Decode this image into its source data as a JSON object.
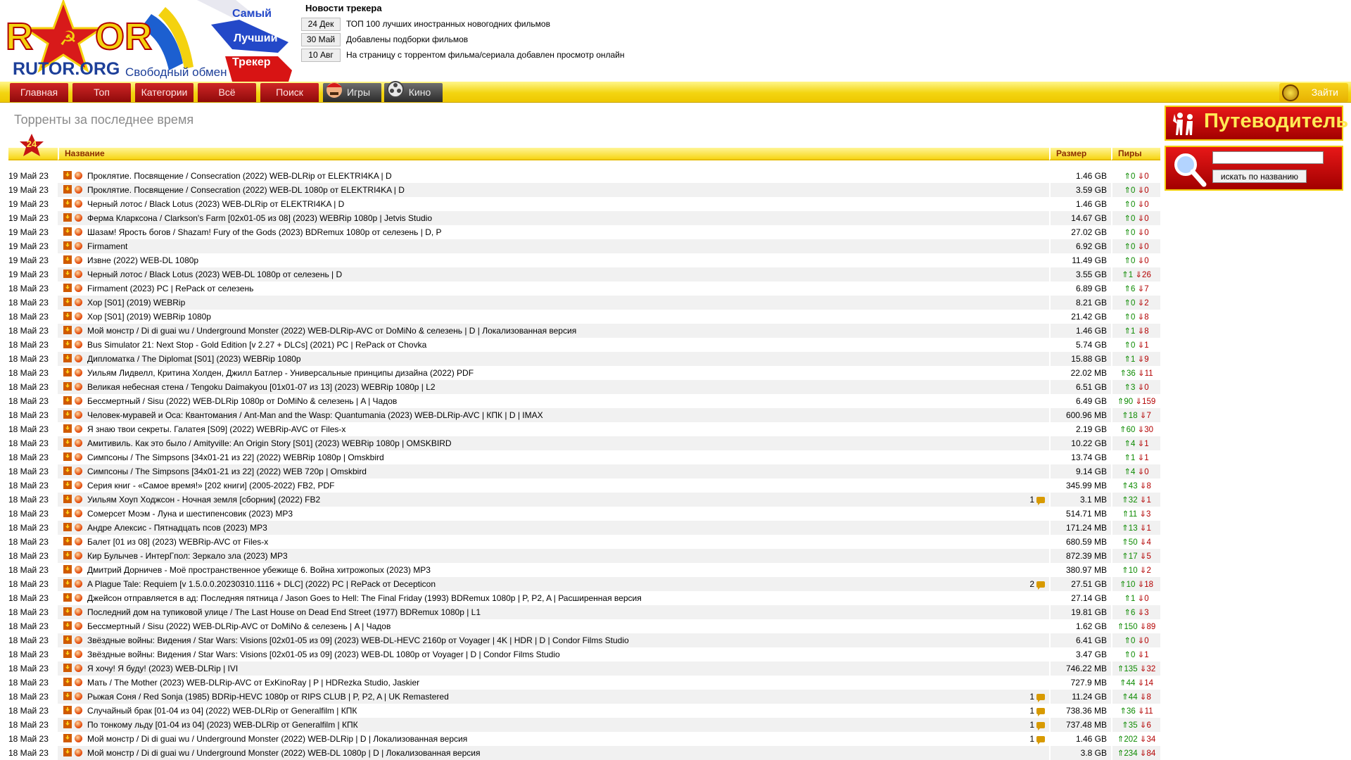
{
  "logo": {
    "text": "RUTOR.ORG",
    "slogan": "Свободный обмен",
    "flag_words": [
      "Самый",
      "Лучший",
      "Трекер"
    ]
  },
  "news": {
    "title": "Новости трекера",
    "items": [
      {
        "date": "24 Дек",
        "text": "ТОП 100 лучших иностранных новогодних фильмов"
      },
      {
        "date": "30 Май",
        "text": "Добавлены подборки фильмов"
      },
      {
        "date": "10 Авг",
        "text": "На страницу с торрентом фильма/сериала добавлен просмотр онлайн"
      }
    ]
  },
  "nav": {
    "tabs": [
      "Главная",
      "Топ",
      "Категории",
      "Всё",
      "Поиск"
    ],
    "games": "Игры",
    "kino": "Кино",
    "login": "Зайти"
  },
  "page_title": "Торренты за последнее время",
  "table": {
    "badge": "24",
    "headers": {
      "name": "Название",
      "size": "Размер",
      "peers": "Пиры"
    },
    "rows": [
      {
        "date": "19 Май 23",
        "title": "Проклятие. Посвящение / Consecration (2022) WEB-DLRip от ELEKTRI4KA | D",
        "com": "",
        "size": "1.46 GB",
        "seed": "0",
        "leech": "0"
      },
      {
        "date": "19 Май 23",
        "title": "Проклятие. Посвящение / Consecration (2022) WEB-DL 1080p от ELEKTRI4KA | D",
        "com": "",
        "size": "3.59 GB",
        "seed": "0",
        "leech": "0"
      },
      {
        "date": "19 Май 23",
        "title": "Черный лотос / Black Lotus (2023) WEB-DLRip от ELEKTRI4KA | D",
        "com": "",
        "size": "1.46 GB",
        "seed": "0",
        "leech": "0"
      },
      {
        "date": "19 Май 23",
        "title": "Ферма Кларксона / Clarkson's Farm [02x01-05 из 08] (2023) WEBRip 1080p | Jetvis Studio",
        "com": "",
        "size": "14.67 GB",
        "seed": "0",
        "leech": "0"
      },
      {
        "date": "19 Май 23",
        "title": "Шазам! Ярость богов / Shazam! Fury of the Gods (2023) BDRemux 1080p от селезень | D, P",
        "com": "",
        "size": "27.02 GB",
        "seed": "0",
        "leech": "0"
      },
      {
        "date": "19 Май 23",
        "title": "Firmament",
        "com": "",
        "size": "6.92 GB",
        "seed": "0",
        "leech": "0"
      },
      {
        "date": "19 Май 23",
        "title": "Извне (2022) WEB-DL 1080p",
        "com": "",
        "size": "11.49 GB",
        "seed": "0",
        "leech": "0"
      },
      {
        "date": "19 Май 23",
        "title": "Черный лотос / Black Lotus (2023) WEB-DL 1080p от селезень | D",
        "com": "",
        "size": "3.55 GB",
        "seed": "1",
        "leech": "26"
      },
      {
        "date": "18 Май 23",
        "title": "Firmament (2023) PC | RePack от селезень",
        "com": "",
        "size": "6.89 GB",
        "seed": "6",
        "leech": "7"
      },
      {
        "date": "18 Май 23",
        "title": "Хор [S01] (2019) WEBRip",
        "com": "",
        "size": "8.21 GB",
        "seed": "0",
        "leech": "2"
      },
      {
        "date": "18 Май 23",
        "title": "Хор [S01] (2019) WEBRip 1080p",
        "com": "",
        "size": "21.42 GB",
        "seed": "0",
        "leech": "8"
      },
      {
        "date": "18 Май 23",
        "title": "Мой монстр / Di di guai wu / Underground Monster (2022) WEB-DLRip-AVC от DoMiNo & селезень | D | Локализованная версия",
        "com": "",
        "size": "1.46 GB",
        "seed": "1",
        "leech": "8"
      },
      {
        "date": "18 Май 23",
        "title": "Bus Simulator 21: Next Stop - Gold Edition [v 2.27 + DLCs] (2021) PC | RePack от Chovka",
        "com": "",
        "size": "5.74 GB",
        "seed": "0",
        "leech": "1"
      },
      {
        "date": "18 Май 23",
        "title": "Дипломатка / The Diplomat [S01] (2023) WEBRip 1080p",
        "com": "",
        "size": "15.88 GB",
        "seed": "1",
        "leech": "9"
      },
      {
        "date": "18 Май 23",
        "title": "Уильям Лидвелл, Критина Холден, Джилл Батлер - Универсальные принципы дизайна (2022) PDF",
        "com": "",
        "size": "22.02 MB",
        "seed": "36",
        "leech": "11"
      },
      {
        "date": "18 Май 23",
        "title": "Великая небесная стена / Tengoku Daimakyou [01x01-07 из 13] (2023) WEBRip 1080p | L2",
        "com": "",
        "size": "6.51 GB",
        "seed": "3",
        "leech": "0"
      },
      {
        "date": "18 Май 23",
        "title": "Бессмертный / Sisu (2022) WEB-DLRip 1080p от DoMiNo & селезень | A | Чадов",
        "com": "",
        "size": "6.49 GB",
        "seed": "90",
        "leech": "159"
      },
      {
        "date": "18 Май 23",
        "title": "Человек-муравей и Оса: Квантомания / Ant-Man and the Wasp: Quantumania (2023) WEB-DLRip-AVC | КПК | D | IMAX",
        "com": "",
        "size": "600.96 MB",
        "seed": "18",
        "leech": "7"
      },
      {
        "date": "18 Май 23",
        "title": "Я знаю твои секреты. Галатея [S09] (2022) WEBRip-AVC от Files-x",
        "com": "",
        "size": "2.19 GB",
        "seed": "60",
        "leech": "30"
      },
      {
        "date": "18 Май 23",
        "title": "Амитивиль. Как это было / Amityville: An Origin Story [S01] (2023) WEBRip 1080p | OMSKBIRD",
        "com": "",
        "size": "10.22 GB",
        "seed": "4",
        "leech": "1"
      },
      {
        "date": "18 Май 23",
        "title": "Симпсоны / The Simpsons [34x01-21 из 22] (2022) WEBRip 1080p | Omskbird",
        "com": "",
        "size": "13.74 GB",
        "seed": "1",
        "leech": "1"
      },
      {
        "date": "18 Май 23",
        "title": "Симпсоны / The Simpsons [34x01-21 из 22] (2022) WEB 720p | Omskbird",
        "com": "",
        "size": "9.14 GB",
        "seed": "4",
        "leech": "0"
      },
      {
        "date": "18 Май 23",
        "title": "Серия книг - «Самое время!» [202 книги] (2005-2022) FB2, PDF",
        "com": "",
        "size": "345.99 MB",
        "seed": "43",
        "leech": "8"
      },
      {
        "date": "18 Май 23",
        "title": "Уильям Хоуп Ходжсон - Ночная земля [сборник] (2022) FB2",
        "com": "1",
        "size": "3.1 MB",
        "seed": "32",
        "leech": "1"
      },
      {
        "date": "18 Май 23",
        "title": "Сомерсет Моэм - Луна и шестипенсовик (2023) MP3",
        "com": "",
        "size": "514.71 MB",
        "seed": "11",
        "leech": "3"
      },
      {
        "date": "18 Май 23",
        "title": "Андре Алексис - Пятнадцать псов (2023) MP3",
        "com": "",
        "size": "171.24 MB",
        "seed": "13",
        "leech": "1"
      },
      {
        "date": "18 Май 23",
        "title": "Балет [01 из 08] (2023) WEBRip-AVC от Files-x",
        "com": "",
        "size": "680.59 MB",
        "seed": "50",
        "leech": "4"
      },
      {
        "date": "18 Май 23",
        "title": "Кир Булычев - ИнтерГпол: Зеркало зла (2023) MP3",
        "com": "",
        "size": "872.39 MB",
        "seed": "17",
        "leech": "5"
      },
      {
        "date": "18 Май 23",
        "title": "Дмитрий Дорничев - Моё пространственное убежище 6. Война хитрожопых (2023) MP3",
        "com": "",
        "size": "380.97 MB",
        "seed": "10",
        "leech": "2"
      },
      {
        "date": "18 Май 23",
        "title": "A Plague Tale: Requiem [v 1.5.0.0.20230310.1116 + DLC] (2022) PC | RePack от Decepticon",
        "com": "2",
        "size": "27.51 GB",
        "seed": "10",
        "leech": "18"
      },
      {
        "date": "18 Май 23",
        "title": "Джейсон отправляется в ад: Последняя пятница / Jason Goes to Hell: The Final Friday (1993) BDRemux 1080p | P, P2, A | Расширенная версия",
        "com": "",
        "size": "27.14 GB",
        "seed": "1",
        "leech": "0"
      },
      {
        "date": "18 Май 23",
        "title": "Последний дом на тупиковой улице / The Last House on Dead End Street (1977) BDRemux 1080p | L1",
        "com": "",
        "size": "19.81 GB",
        "seed": "6",
        "leech": "3"
      },
      {
        "date": "18 Май 23",
        "title": "Бессмертный / Sisu (2022) WEB-DLRip-AVC от DoMiNo & селезень | A | Чадов",
        "com": "",
        "size": "1.62 GB",
        "seed": "150",
        "leech": "89"
      },
      {
        "date": "18 Май 23",
        "title": "Звёздные войны: Видения / Star Wars: Visions [02x01-05 из 09] (2023) WEB-DL-HEVC 2160p от Voyager | 4K | HDR | D | Condor Films Studio",
        "com": "",
        "size": "6.41 GB",
        "seed": "0",
        "leech": "0"
      },
      {
        "date": "18 Май 23",
        "title": "Звёздные войны: Видения / Star Wars: Visions [02x01-05 из 09] (2023) WEB-DL 1080p от Voyager | D | Condor Films Studio",
        "com": "",
        "size": "3.47 GB",
        "seed": "0",
        "leech": "1"
      },
      {
        "date": "18 Май 23",
        "title": "Я хочу! Я буду! (2023) WEB-DLRip | IVI",
        "com": "",
        "size": "746.22 MB",
        "seed": "135",
        "leech": "32"
      },
      {
        "date": "18 Май 23",
        "title": "Мать / The Mother (2023) WEB-DLRip-AVC от ExKinoRay | P | HDRezka Studio, Jaskier",
        "com": "",
        "size": "727.9 MB",
        "seed": "44",
        "leech": "14"
      },
      {
        "date": "18 Май 23",
        "title": "Рыжая Соня / Red Sonja (1985) BDRip-HEVC 1080p от RIPS CLUB | P, P2, A | UK Remastered",
        "com": "1",
        "size": "11.24 GB",
        "seed": "44",
        "leech": "8"
      },
      {
        "date": "18 Май 23",
        "title": "Случайный брак [01-04 из 04] (2022) WEB-DLRip от Generalfilm | КПК",
        "com": "1",
        "size": "738.36 MB",
        "seed": "36",
        "leech": "11"
      },
      {
        "date": "18 Май 23",
        "title": "По тонкому льду [01-04 из 04] (2023) WEB-DLRip от Generalfilm | КПК",
        "com": "1",
        "size": "737.48 MB",
        "seed": "35",
        "leech": "6"
      },
      {
        "date": "18 Май 23",
        "title": "Мой монстр / Di di guai wu / Underground Monster (2022) WEB-DLRip | D | Локализованная версия",
        "com": "1",
        "size": "1.46 GB",
        "seed": "202",
        "leech": "34"
      },
      {
        "date": "18 Май 23",
        "title": "Мой монстр / Di di guai wu / Underground Monster (2022) WEB-DL 1080p | D | Локализованная версия",
        "com": "",
        "size": "3.8 GB",
        "seed": "234",
        "leech": "84"
      }
    ]
  },
  "sidebar": {
    "guide": "Путеводитель",
    "search_button": "искать по названию",
    "search_value": ""
  },
  "colors": {
    "accent_red": "#c41414",
    "accent_yellow": "#f3d511",
    "seed_green": "#0c8a00",
    "leech_red": "#b30000"
  }
}
